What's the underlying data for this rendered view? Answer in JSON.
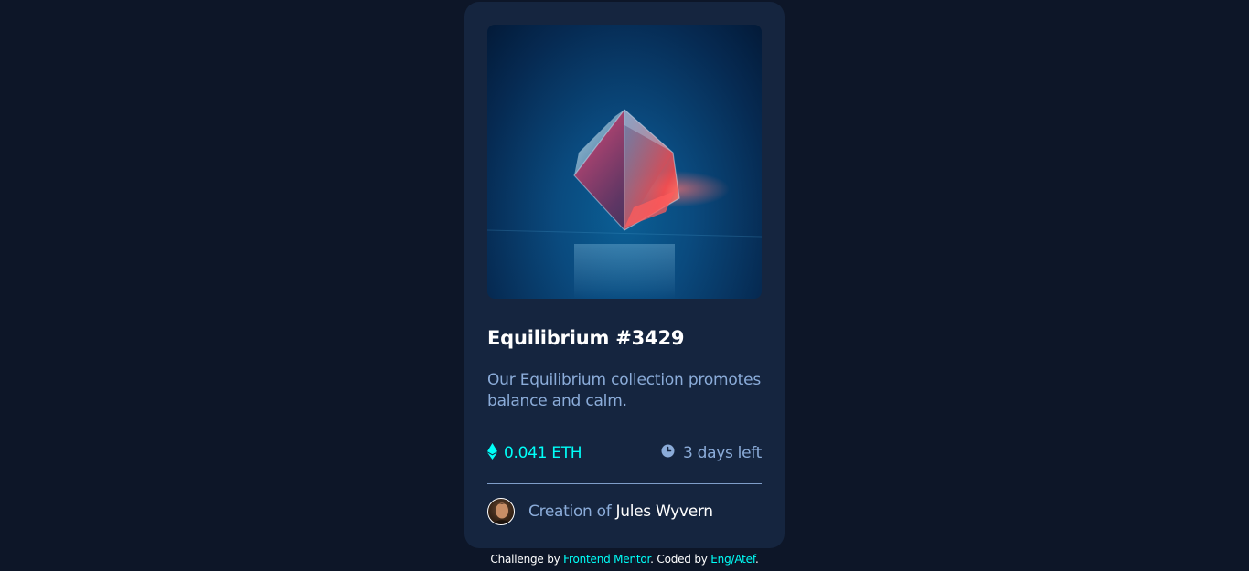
{
  "card": {
    "title": "Equilibrium #3429",
    "description": "Our Equilibrium collection promotes balance and calm.",
    "price": "0.041 ETH",
    "time_left": "3 days left",
    "creator_prefix": "Creation of",
    "creator_name": "Jules Wyvern",
    "icons": {
      "price": "ethereum-icon",
      "time": "clock-icon"
    }
  },
  "attribution": {
    "part1": "Challenge by ",
    "link1": "Frontend Mentor",
    "part2": ". Coded by ",
    "link2": "Eng/Atef",
    "part3": "."
  },
  "colors": {
    "page_bg": "#0d1628",
    "card_bg": "#15253f",
    "accent": "#00fff8",
    "soft_blue": "#8bacd9",
    "white": "#ffffff"
  }
}
